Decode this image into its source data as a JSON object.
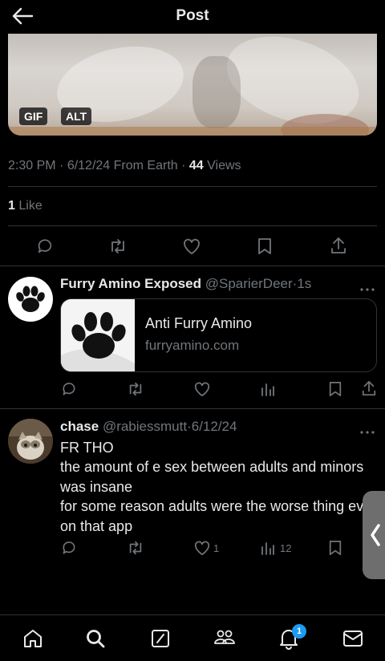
{
  "header": {
    "title": "Post"
  },
  "media": {
    "gif_badge": "GIF",
    "alt_badge": "ALT"
  },
  "post_meta": {
    "time": "2:30 PM",
    "date": "6/12/24",
    "source": "From Earth",
    "views_count": "44",
    "views_label": "Views",
    "likes_count": "1",
    "likes_label": "Like"
  },
  "replies": [
    {
      "name": "Furry Amino Exposed",
      "handle": "@SparierDeer",
      "time": "1s",
      "card": {
        "title": "Anti Furry Amino",
        "domain": "furryamino.com"
      }
    },
    {
      "name": "chase",
      "handle": "@rabiessmutt",
      "time": "6/12/24",
      "lines": [
        "FR THO",
        "the amount of e sex between adults and minors was insane",
        "for some reason adults were the worse thing ever on that app"
      ],
      "likes": "1",
      "views": "12"
    }
  ],
  "nav": {
    "notification_count": "1"
  },
  "icons": [
    "back-arrow-icon",
    "reply-icon",
    "retweet-icon",
    "like-icon",
    "bookmark-icon",
    "share-icon",
    "views-icon",
    "more-icon",
    "home-icon",
    "search-icon",
    "compose-icon",
    "communities-icon",
    "notifications-icon",
    "messages-icon",
    "chevron-left-icon"
  ],
  "colors": {
    "background": "#000000",
    "text": "#e7e9ea",
    "muted": "#71767b",
    "divider": "#2f3336",
    "badge": "#1d9bf0"
  }
}
